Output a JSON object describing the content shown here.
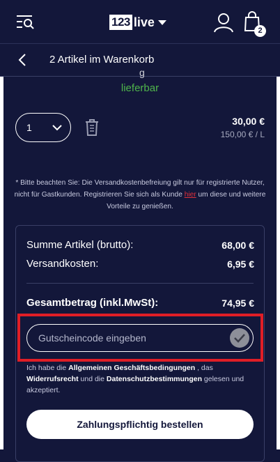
{
  "header": {
    "logo_box": "123",
    "logo_text": "live",
    "cart_count": "2"
  },
  "cart": {
    "title": "2 Artikel im Warenkorb",
    "cut_text": "g",
    "availability": "lieferbar",
    "quantity": "1",
    "price": "30,00 €",
    "unit_price": "150,00 € / L"
  },
  "note": {
    "text_before": "* Bitte beachten Sie: Die Versandkostenbefreiung gilt nur für registrierte Nutzer, nicht für Gastkunden. Registrieren Sie sich als Kunde ",
    "link": "hier",
    "text_after": " um diese und weitere Vorteile zu genießen."
  },
  "summary": {
    "items_label": "Summe Artikel (brutto):",
    "items_value": "68,00 €",
    "shipping_label": "Versandkosten:",
    "shipping_value": "6,95 €",
    "total_label": "Gesamtbetrag (inkl.MwSt):",
    "total_value": "74,95 €"
  },
  "coupon": {
    "placeholder": "Gutscheincode eingeben"
  },
  "terms": {
    "t1": "Ich habe die ",
    "l1": "Allgemeinen Geschäftsbedingungen",
    "t2": " , das ",
    "l2": "Widerrufsrecht",
    "t3": " und die ",
    "l3": "Datenschutzbestimmungen",
    "t4": " gelesen und akzeptiert."
  },
  "order_button": "Zahlungspflichtig bestellen",
  "colors": {
    "background": "#13173a",
    "available_green": "#4fb54b",
    "link_red": "#e0303a",
    "highlight_red": "#e01e26"
  },
  "icons": [
    "menu-search-icon",
    "user-icon",
    "shopping-bag-icon",
    "back-chevron-icon",
    "chevron-down-icon",
    "trash-icon",
    "checkmark-icon"
  ]
}
